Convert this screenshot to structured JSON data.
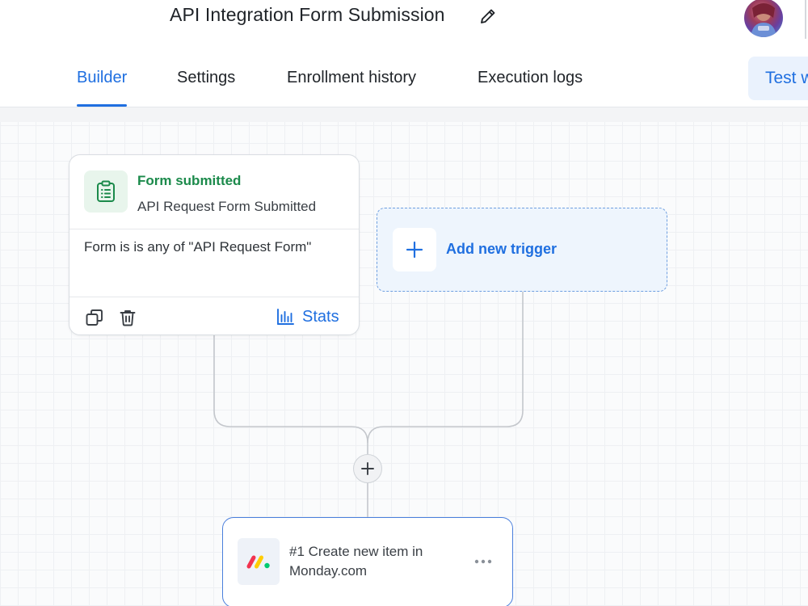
{
  "header": {
    "title": "API Integration Form Submission",
    "edit_icon": "pencil-icon"
  },
  "tabs": [
    {
      "label": "Builder",
      "active": true
    },
    {
      "label": "Settings",
      "active": false
    },
    {
      "label": "Enrollment history",
      "active": false
    },
    {
      "label": "Execution logs",
      "active": false
    }
  ],
  "test_button": {
    "label": "Test w"
  },
  "trigger": {
    "kind": "Form submitted",
    "name": "API Request Form Submitted",
    "condition": "Form is is any of \"API Request Form\"",
    "icon": "clipboard-icon",
    "stats_label": "Stats"
  },
  "add_trigger": {
    "label": "Add new trigger"
  },
  "action": {
    "title": "#1 Create new item in Monday.com",
    "icon": "monday-logo-icon"
  },
  "colors": {
    "accent": "#1f6fe0",
    "success": "#1b8a4b",
    "accent_light": "#eaf2fd"
  }
}
